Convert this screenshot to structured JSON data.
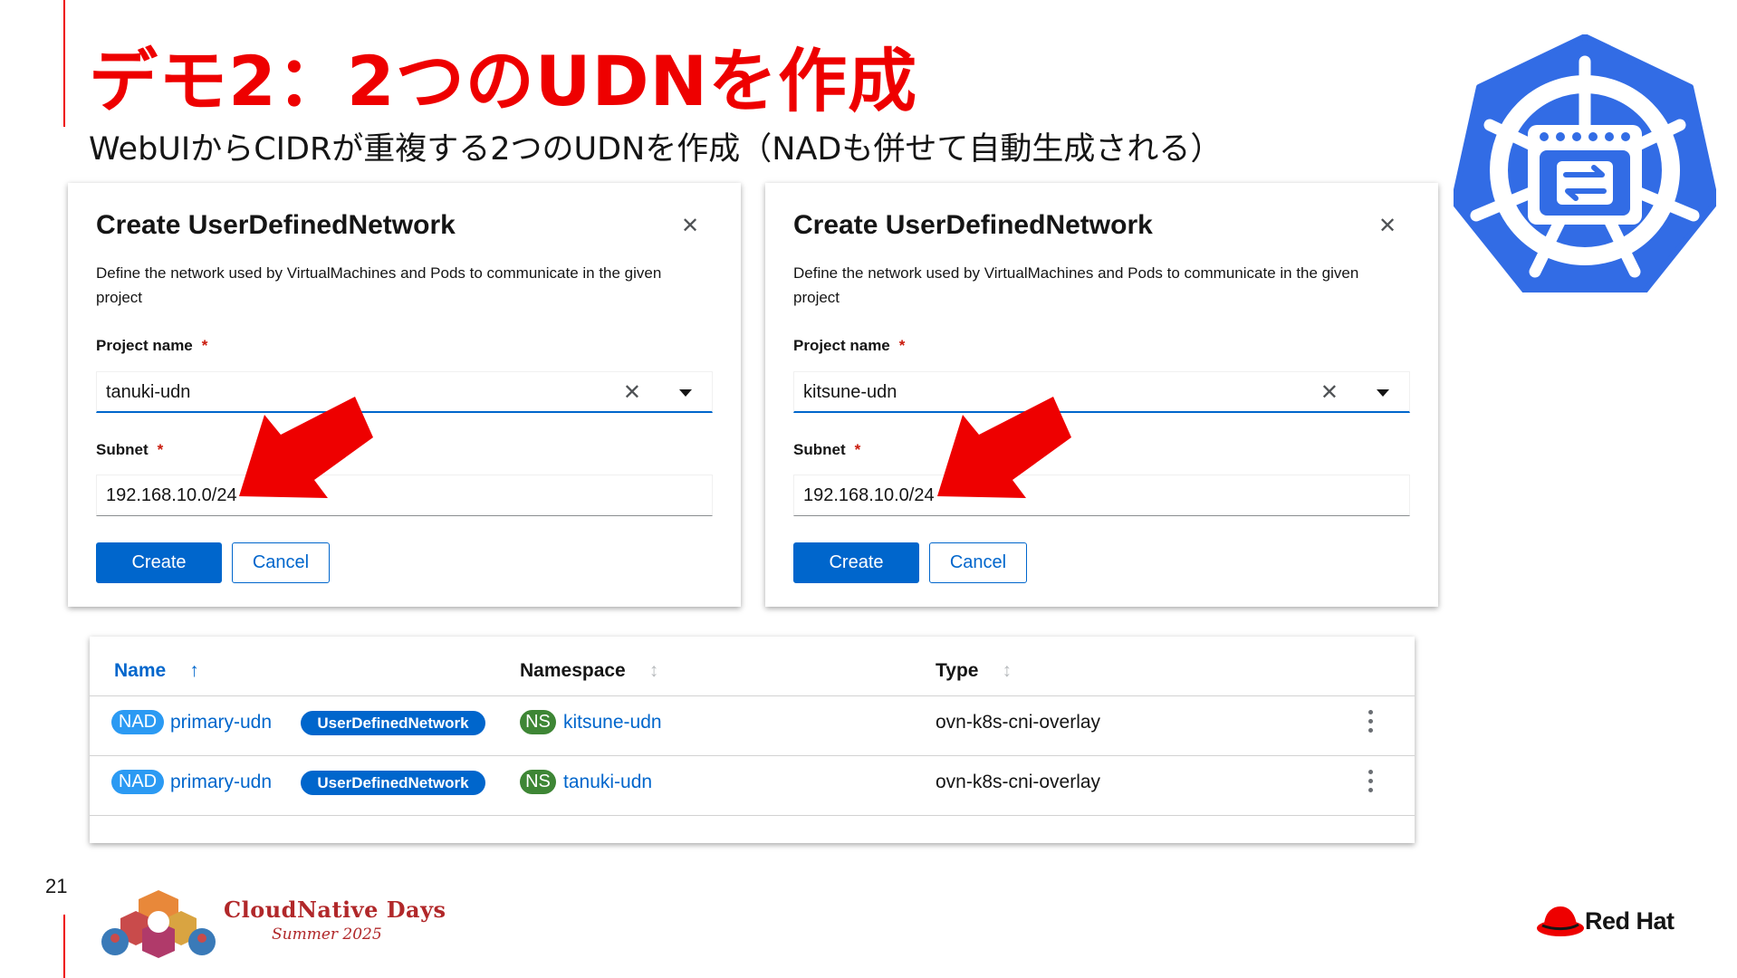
{
  "slide": {
    "title": "デモ2：2つのUDNを作成",
    "subtitle": "WebUIからCIDRが重複する2つのUDNを作成（NADも併せて自動生成される）",
    "page_number": "21",
    "accent_color": "#ee0000"
  },
  "modals": [
    {
      "title": "Create UserDefinedNetwork",
      "description": "Define the network used by VirtualMachines and Pods to communicate in the given project",
      "project_label": "Project name",
      "required_mark": "*",
      "project_value": "tanuki-udn",
      "subnet_label": "Subnet",
      "subnet_value": "192.168.10.0/24",
      "create_label": "Create",
      "cancel_label": "Cancel"
    },
    {
      "title": "Create UserDefinedNetwork",
      "description": "Define the network used by VirtualMachines and Pods to communicate in the given project",
      "project_label": "Project name",
      "required_mark": "*",
      "project_value": "kitsune-udn",
      "subnet_label": "Subnet",
      "subnet_value": "192.168.10.0/24",
      "create_label": "Create",
      "cancel_label": "Cancel"
    }
  ],
  "table": {
    "columns": {
      "name": "Name",
      "namespace": "Namespace",
      "type": "Type"
    },
    "sort_icons": {
      "active": "↑",
      "inactive": "↕"
    },
    "rows": [
      {
        "kind_badge": "NAD",
        "name": "primary-udn",
        "owner_label": "UserDefinedNetwork",
        "ns_badge": "NS",
        "namespace": "kitsune-udn",
        "type": "ovn-k8s-cni-overlay"
      },
      {
        "kind_badge": "NAD",
        "name": "primary-udn",
        "owner_label": "UserDefinedNetwork",
        "ns_badge": "NS",
        "namespace": "tanuki-udn",
        "type": "ovn-k8s-cni-overlay"
      }
    ]
  },
  "footer": {
    "event_name": "CloudNative Days",
    "event_season": "Summer 2025",
    "vendor": "Red Hat"
  },
  "icons": {
    "close": "close-icon",
    "clear": "clear-icon",
    "caret": "caret-down-icon",
    "kebab": "kebab-icon",
    "kubernetes": "kubernetes-logo",
    "redhat": "redhat-logo"
  },
  "colors": {
    "primary_blue": "#0066cc",
    "nad_badge": "#2b9af3",
    "ns_badge": "#3e8635",
    "kubernetes_blue": "#326ce5",
    "arrow_red": "#ee0000"
  }
}
